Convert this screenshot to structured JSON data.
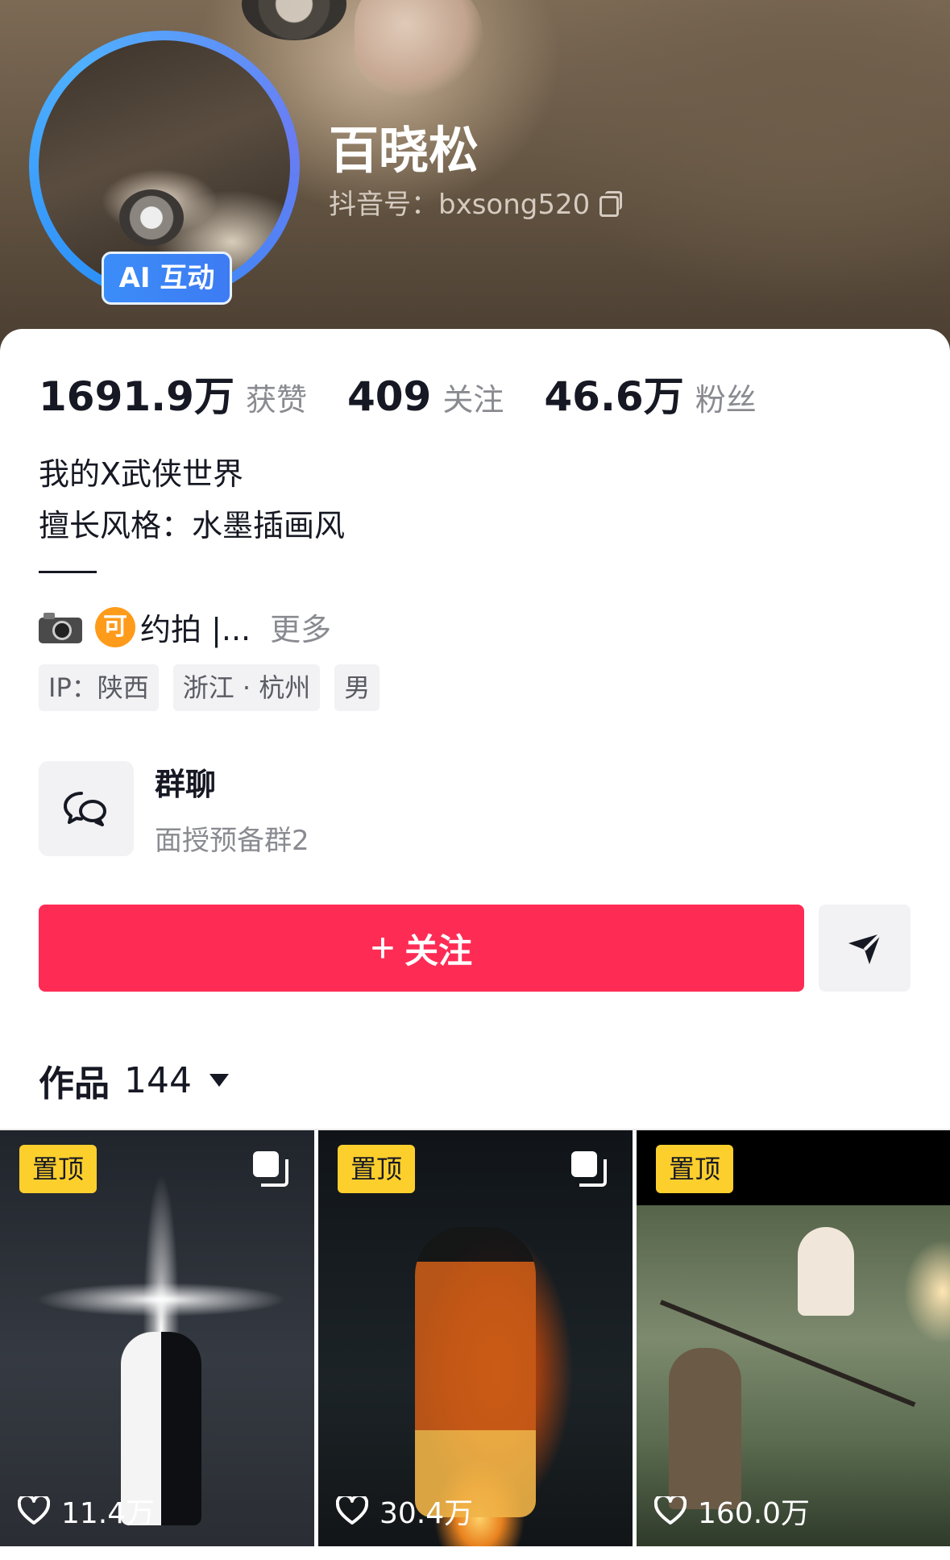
{
  "profile": {
    "name": "百晓松",
    "douyin_id": "抖音号：bxsong520",
    "avatar_badge": "AI 互动"
  },
  "stats": [
    {
      "value": "1691.9万",
      "label": "获赞"
    },
    {
      "value": "409",
      "label": "关注"
    },
    {
      "value": "46.6万",
      "label": "粉丝"
    }
  ],
  "bio": {
    "line1": "我的X武侠世界",
    "line2": "擅长风格：水墨插画风",
    "extra_badge": "可",
    "extra_text": "约拍 |...",
    "more": "更多"
  },
  "tags": [
    "IP：陕西",
    "浙江 · 杭州",
    "男"
  ],
  "group_chat": {
    "title": "群聊",
    "subtitle": "面授预备群2"
  },
  "actions": {
    "follow_label": "关注",
    "follow_plus": "+"
  },
  "works": {
    "label": "作品",
    "count": "144"
  },
  "videos": [
    {
      "badge": "置顶",
      "likes": "11.4万",
      "multi": true
    },
    {
      "badge": "置顶",
      "likes": "30.4万",
      "multi": true
    },
    {
      "badge": "置顶",
      "likes": "160.0万",
      "multi": false
    }
  ],
  "colors": {
    "follow_button": "#fe2c55",
    "pin_badge": "#fdcf2d",
    "avatar_ring": "#2a8ef7"
  }
}
